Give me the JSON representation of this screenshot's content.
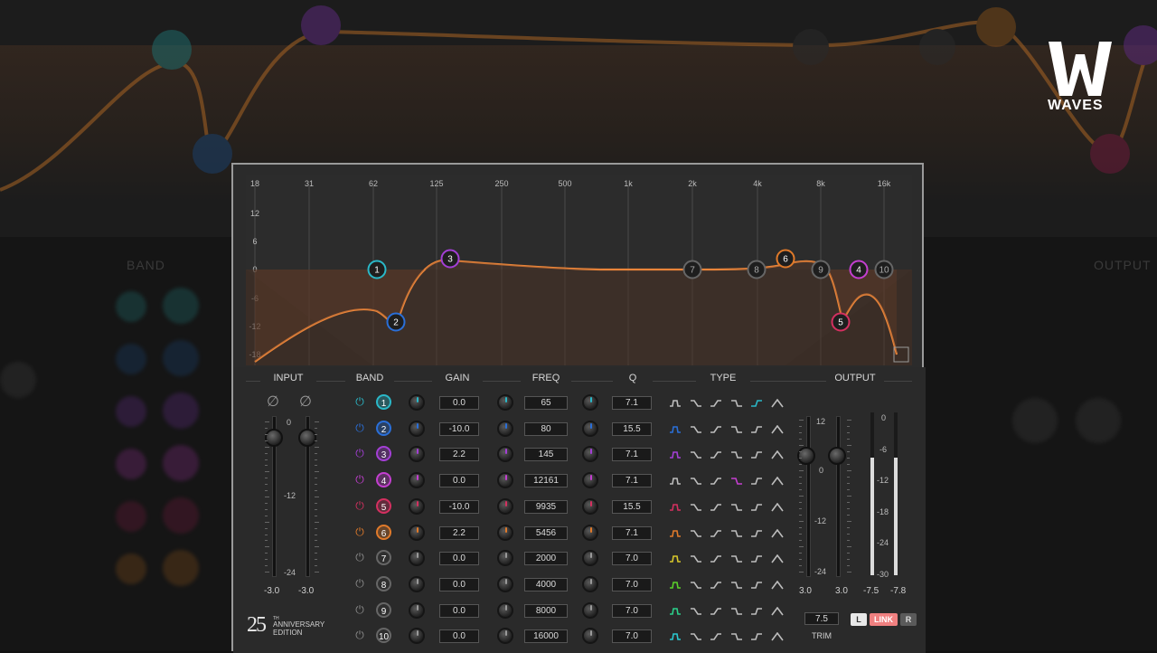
{
  "brand": {
    "name": "WAVES"
  },
  "background": {
    "labels": [
      "BAND",
      "OUTPUT"
    ]
  },
  "graph": {
    "freq_labels": [
      "18",
      "31",
      "62",
      "125",
      "250",
      "500",
      "1k",
      "2k",
      "4k",
      "8k",
      "16k"
    ],
    "gain_labels": [
      "12",
      "6",
      "0",
      "-6",
      "-12",
      "-18"
    ],
    "nodes": [
      {
        "label": "1",
        "color": "#2ab8c8"
      },
      {
        "label": "2",
        "color": "#2a6fd8"
      },
      {
        "label": "3",
        "color": "#a43fd6"
      },
      {
        "label": "7",
        "color": "#666666"
      },
      {
        "label": "8",
        "color": "#666666"
      },
      {
        "label": "6",
        "color": "#e07a2a"
      },
      {
        "label": "9",
        "color": "#666666"
      },
      {
        "label": "4",
        "color": "#c43fd0"
      },
      {
        "label": "10",
        "color": "#666666"
      },
      {
        "label": "5",
        "color": "#d43060"
      }
    ]
  },
  "headers": {
    "input": "INPUT",
    "band": "BAND",
    "gain": "GAIN",
    "freq": "FREQ",
    "q": "Q",
    "type": "TYPE",
    "output": "OUTPUT"
  },
  "bands": [
    {
      "num": "1",
      "gain": "0.0",
      "freq": "65",
      "q": "7.1",
      "color": "#2ab8c8",
      "active": true,
      "sel_type": 4
    },
    {
      "num": "2",
      "gain": "-10.0",
      "freq": "80",
      "q": "15.5",
      "color": "#2a6fd8",
      "active": true,
      "sel_type": 0
    },
    {
      "num": "3",
      "gain": "2.2",
      "freq": "145",
      "q": "7.1",
      "color": "#a43fd6",
      "active": true,
      "sel_type": 0
    },
    {
      "num": "4",
      "gain": "0.0",
      "freq": "12161",
      "q": "7.1",
      "color": "#c43fd0",
      "active": true,
      "sel_type": 3
    },
    {
      "num": "5",
      "gain": "-10.0",
      "freq": "9935",
      "q": "15.5",
      "color": "#d43060",
      "active": true,
      "sel_type": 0
    },
    {
      "num": "6",
      "gain": "2.2",
      "freq": "5456",
      "q": "7.1",
      "color": "#e07a2a",
      "active": true,
      "sel_type": 0
    },
    {
      "num": "7",
      "gain": "0.0",
      "freq": "2000",
      "q": "7.0",
      "color": "#d8c82a",
      "active": false,
      "sel_type": 0
    },
    {
      "num": "8",
      "gain": "0.0",
      "freq": "4000",
      "q": "7.0",
      "color": "#5ad02a",
      "active": false,
      "sel_type": 0
    },
    {
      "num": "9",
      "gain": "0.0",
      "freq": "8000",
      "q": "7.0",
      "color": "#2ad08a",
      "active": false,
      "sel_type": 0
    },
    {
      "num": "10",
      "gain": "0.0",
      "freq": "16000",
      "q": "7.0",
      "color": "#2ac8d0",
      "active": false,
      "sel_type": 0
    }
  ],
  "input": {
    "phase_icon": "phase-invert-icon",
    "scale": [
      "0",
      "-12",
      "-24"
    ],
    "left_value": "-3.0",
    "right_value": "-3.0"
  },
  "output": {
    "gain_scale": [
      "12",
      "0",
      "-12",
      "-24"
    ],
    "left_value": "3.0",
    "right_value": "3.0",
    "meter_scale": [
      "0",
      "-6",
      "-12",
      "-18",
      "-24",
      "-30"
    ],
    "meter_left": "-7.5",
    "meter_right": "-7.8",
    "meter_level_left": 0.72,
    "meter_level_right": 0.72,
    "trim_value": "7.5",
    "trim_label": "TRIM",
    "link": {
      "l": "L",
      "link": "LINK",
      "r": "R"
    }
  },
  "edition": {
    "number": "25",
    "sup": "TH",
    "line1": "ANNIVERSARY",
    "line2": "EDITION"
  }
}
